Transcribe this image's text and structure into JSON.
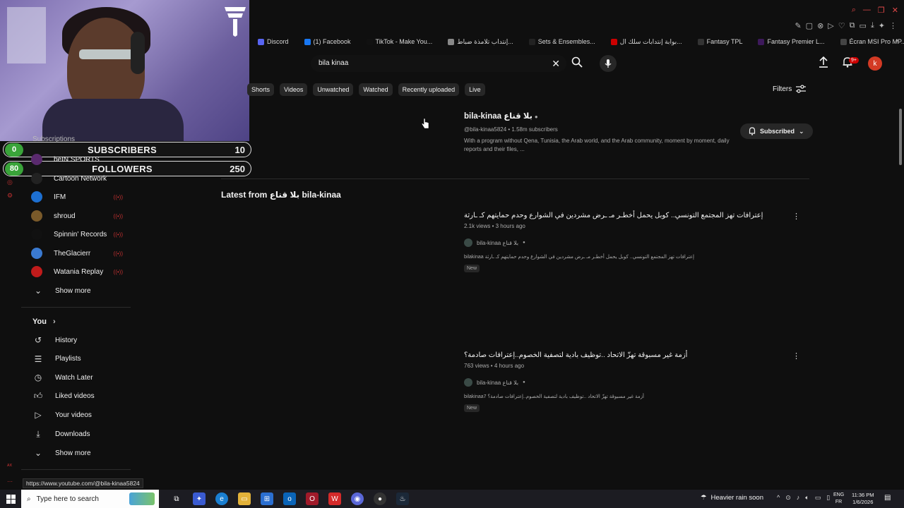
{
  "bookmarks": [
    {
      "label": "Discord",
      "color": "#5865f2"
    },
    {
      "label": "(1) Facebook",
      "color": "#1877f2"
    },
    {
      "label": "TikTok - Make You...",
      "color": "#111111"
    },
    {
      "label": "إنتداب تلامذة ضباط...",
      "color": "#888888"
    },
    {
      "label": "Sets & Ensembles...",
      "color": "#222222"
    },
    {
      "label": "بوابة إنتدابات سلك ال...",
      "color": "#cc0000"
    },
    {
      "label": "Fantasy TPL",
      "color": "#333333"
    },
    {
      "label": "Fantasy Premier L...",
      "color": "#3d195b"
    },
    {
      "label": "Écran MSI Pro MP...",
      "color": "#444444"
    }
  ],
  "overlay": {
    "subscribers": {
      "current": "0",
      "label": "SUBSCRIBERS",
      "goal": "10"
    },
    "followers": {
      "current": "80",
      "label": "FOLLOWERS",
      "goal": "250"
    }
  },
  "sidebar": {
    "subscriptions_label": "Subscriptions",
    "subscriptions": [
      {
        "label": "beIN SPORTS",
        "color": "#5a2a6e"
      },
      {
        "label": "Cartoon Network",
        "color": "#222222"
      },
      {
        "label": "IFM",
        "color": "#1d6fd1"
      },
      {
        "label": "shroud",
        "color": "#7a5a2a"
      },
      {
        "label": "Spinnin' Records",
        "color": "#111111"
      },
      {
        "label": "TheGlacierr",
        "color": "#3a7ad1"
      },
      {
        "label": "Watania Replay",
        "color": "#c01b1b"
      }
    ],
    "show_more_1": "Show more",
    "you_label": "You",
    "you_items": [
      {
        "label": "History",
        "icon": "history-icon"
      },
      {
        "label": "Playlists",
        "icon": "playlists-icon"
      },
      {
        "label": "Watch Later",
        "icon": "watch-later-icon"
      },
      {
        "label": "Liked videos",
        "icon": "liked-icon"
      },
      {
        "label": "Your videos",
        "icon": "your-videos-icon"
      },
      {
        "label": "Downloads",
        "icon": "download-icon"
      }
    ],
    "show_more_2": "Show more"
  },
  "search": {
    "query": "bila kinaa"
  },
  "header": {
    "notif_badge": "9+",
    "avatar_letter": "k"
  },
  "chips": [
    "Shorts",
    "Videos",
    "Unwatched",
    "Watched",
    "Recently uploaded",
    "Live"
  ],
  "filters_label": "Filters",
  "channel": {
    "name": "bila-kinaa بلا قناع",
    "meta": "@bila-kinaa5824 • 1.58m subscribers",
    "description": "With a program without Qena, Tunisia, the Arab world, and the Arab community, moment by moment, daily reports and their files, ...",
    "subscribed_label": "Subscribed"
  },
  "latest_heading": "Latest from بلا قناع bila-kinaa",
  "videos": [
    {
      "title": "إعترافات تهز المجتمع التونسي.. كوبل يحمل أخطـر مـ ـرض مشردين في الشوارع وحدم حمايتهم كـ ـارثة",
      "meta": "2.1k views • 3 hours ago",
      "channel": "bila-kinaa بلا قناع",
      "desc": "bilakinaa إعترافات تهز المجتمع التونسي.. كوبل يحمل أخطـر مـ ـرض مشردين في الشوارع وحدم حمايتهم كـ ـارثة",
      "badge": "New"
    },
    {
      "title": "أزمة غير مسبوقة تهزّ الاتحاد ..توظيف بادية لتصفية الخصوم..إعترافات صادمة؟",
      "meta": "763 views • 4 hours ago",
      "channel": "bila-kinaa بلا قناع",
      "desc": "bilakinaa7 أزمة غير مسبوقة تهزّ الاتحاد ..توظيف بادية لتصفية الخصوم..إعترافات صادمة؟",
      "badge": "New"
    }
  ],
  "status_url": "https://www.youtube.com/@bila-kinaa5824",
  "taskbar": {
    "search_placeholder": "Type here to search",
    "weather": "Heavier rain soon",
    "lang_top": "ENG",
    "lang_bottom": "FR",
    "time": "11:36 PM",
    "date": "1/6/2026"
  }
}
